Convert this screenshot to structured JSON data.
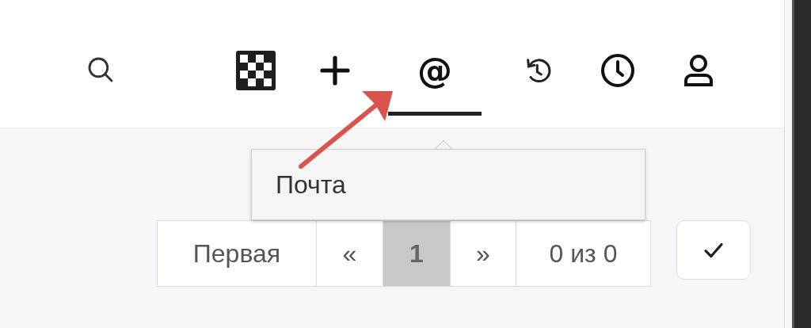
{
  "toolbar": {
    "search": {
      "kind": "search"
    },
    "tabs": [
      {
        "kind": "checker",
        "selected": false
      },
      {
        "kind": "plus",
        "selected": false
      },
      {
        "kind": "text",
        "label": "@",
        "selected": true
      },
      {
        "kind": "history",
        "selected": false
      },
      {
        "kind": "clock",
        "selected": false
      },
      {
        "kind": "user",
        "selected": false
      }
    ]
  },
  "tooltip": {
    "text": "Почта"
  },
  "pagination": {
    "items": [
      {
        "label": "Первая",
        "selected": false
      },
      {
        "label": "«",
        "selected": false
      },
      {
        "label": "1",
        "selected": true
      },
      {
        "label": "»",
        "selected": false
      },
      {
        "label": "0 из 0",
        "selected": false
      }
    ]
  },
  "confirm_button": {
    "kind": "check"
  }
}
